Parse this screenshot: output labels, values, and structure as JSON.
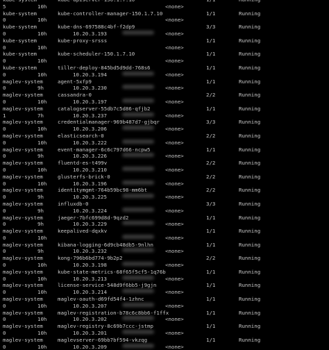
{
  "terminal": {
    "rows": [
      {
        "ns": "kube-system",
        "name": "kube-apiserver-150.1.7.10",
        "ip": "",
        "ready": "1/1",
        "status": "Running",
        "restarts": "5",
        "age": "10h",
        "blur": false
      },
      {
        "ns": "kube-system",
        "name": "kube-controller-manager-150.1.7.10",
        "ip": "",
        "ready": "1/1",
        "status": "Running",
        "restarts": "0",
        "age": "10h",
        "blur": false
      },
      {
        "ns": "kube-system",
        "name": "kube-dns-697588c4bf-f2dp9",
        "ip": "10.20.3.193",
        "ready": "3/3",
        "status": "Running",
        "restarts": "0",
        "age": "10h",
        "blur": true
      },
      {
        "ns": "kube-system",
        "name": "kube-proxy-srsss",
        "ip": "",
        "ready": "1/1",
        "status": "Running",
        "restarts": "0",
        "age": "10h",
        "blur": false
      },
      {
        "ns": "kube-system",
        "name": "kube-scheduler-150.1.7.10",
        "ip": "",
        "ready": "1/1",
        "status": "Running",
        "restarts": "0",
        "age": "10h",
        "blur": false
      },
      {
        "ns": "kube-system",
        "name": "tiller-deploy-845bd5d9dd-768s6",
        "ip": "10.20.3.194",
        "ready": "1/1",
        "status": "Running",
        "restarts": "0",
        "age": "10h",
        "blur": true
      },
      {
        "ns": "maglev-system",
        "name": "agent-5xfp9",
        "ip": "10.20.3.230",
        "ready": "1/1",
        "status": "Running",
        "restarts": "0",
        "age": "9h",
        "blur": true
      },
      {
        "ns": "maglev-system",
        "name": "cassandra-0",
        "ip": "10.20.3.197",
        "ready": "2/2",
        "status": "Running",
        "restarts": "0",
        "age": "10h",
        "blur": true
      },
      {
        "ns": "maglev-system",
        "name": "catalogserver-55db7c5d86-qfjb2",
        "ip": "10.20.3.237",
        "ready": "1/1",
        "status": "Running",
        "restarts": "1",
        "age": "7h",
        "blur": true
      },
      {
        "ns": "maglev-system",
        "name": "credentialmanager-969b487d7-gjbqr",
        "ip": "10.20.3.206",
        "ready": "3/3",
        "status": "Running",
        "restarts": "0",
        "age": "10h",
        "blur": true
      },
      {
        "ns": "maglev-system",
        "name": "elasticsearch-0",
        "ip": "10.20.3.222",
        "ready": "2/2",
        "status": "Running",
        "restarts": "0",
        "age": "10h",
        "blur": true
      },
      {
        "ns": "maglev-system",
        "name": "event-manager-6c6c797d66-ncpw5",
        "ip": "10.20.3.226",
        "ready": "1/1",
        "status": "Running",
        "restarts": "0",
        "age": "9h",
        "blur": true
      },
      {
        "ns": "maglev-system",
        "name": "fluentd-es-t499v",
        "ip": "10.20.3.210",
        "ready": "2/2",
        "status": "Running",
        "restarts": "0",
        "age": "10h",
        "blur": true
      },
      {
        "ns": "maglev-system",
        "name": "glusterfs-brick-0",
        "ip": "10.20.3.196",
        "ready": "2/2",
        "status": "Running",
        "restarts": "0",
        "age": "10h",
        "blur": true
      },
      {
        "ns": "maglev-system",
        "name": "identitymgmt-764b59bc98-mm6bt",
        "ip": "10.20.3.225",
        "ready": "2/2",
        "status": "Running",
        "restarts": "0",
        "age": "9h",
        "blur": true
      },
      {
        "ns": "maglev-system",
        "name": "influxdb-0",
        "ip": "10.20.3.224",
        "ready": "3/3",
        "status": "Running",
        "restarts": "0",
        "age": "9h",
        "blur": true
      },
      {
        "ns": "maglev-system",
        "name": "jaeger-7bfc699d8d-9qzd2",
        "ip": "10.20.3.229",
        "ready": "1/1",
        "status": "Running",
        "restarts": "0",
        "age": "9h",
        "blur": true
      },
      {
        "ns": "maglev-system",
        "name": "keepalived-dqxkv",
        "ip": "",
        "ready": "1/1",
        "status": "Running",
        "restarts": "0",
        "age": "10h",
        "blur": true
      },
      {
        "ns": "maglev-system",
        "name": "kibana-logging-6d9cb48db5-9nlhn",
        "ip": "10.20.3.232",
        "ready": "1/1",
        "status": "Running",
        "restarts": "0",
        "age": "9h",
        "blur": true
      },
      {
        "ns": "maglev-system",
        "name": "kong-796b6bd774-9b2p2",
        "ip": "10.20.3.198",
        "ready": "2/2",
        "status": "Running",
        "restarts": "0",
        "age": "10h",
        "blur": true
      },
      {
        "ns": "maglev-system",
        "name": "kube-state-metrics-68f65f5cf5-1q76b",
        "ip": "10.20.3.213",
        "ready": "1/1",
        "status": "Running",
        "restarts": "0",
        "age": "10h",
        "blur": true
      },
      {
        "ns": "maglev-system",
        "name": "license-service-548d9f6bb5-j9gjn",
        "ip": "10.20.3.214",
        "ready": "1/1",
        "status": "Running",
        "restarts": "0",
        "age": "10h",
        "blur": true
      },
      {
        "ns": "maglev-system",
        "name": "maglev-oauth-d69fd54f4-1zhnc",
        "ip": "10.20.3.207",
        "ready": "1/1",
        "status": "Running",
        "restarts": "0",
        "age": "10h",
        "blur": true
      },
      {
        "ns": "maglev-system",
        "name": "maglev-registration-b78c6c8bb6-f1ffx",
        "ip": "10.20.3.202",
        "ready": "1/1",
        "status": "Running",
        "restarts": "0",
        "age": "10h",
        "blur": true
      },
      {
        "ns": "maglev-system",
        "name": "maglev-registry-8c69b7ccc-jstmp",
        "ip": "10.20.3.201",
        "ready": "1/1",
        "status": "Running",
        "restarts": "0",
        "age": "10h",
        "blur": true
      },
      {
        "ns": "maglev-system",
        "name": "maglevserver-69bb7bf594-vkzqg",
        "ip": "10.20.3.209",
        "ready": "1/1",
        "status": "Running",
        "restarts": "0",
        "age": "10h",
        "blur": true
      }
    ],
    "none_label": "<none>"
  }
}
